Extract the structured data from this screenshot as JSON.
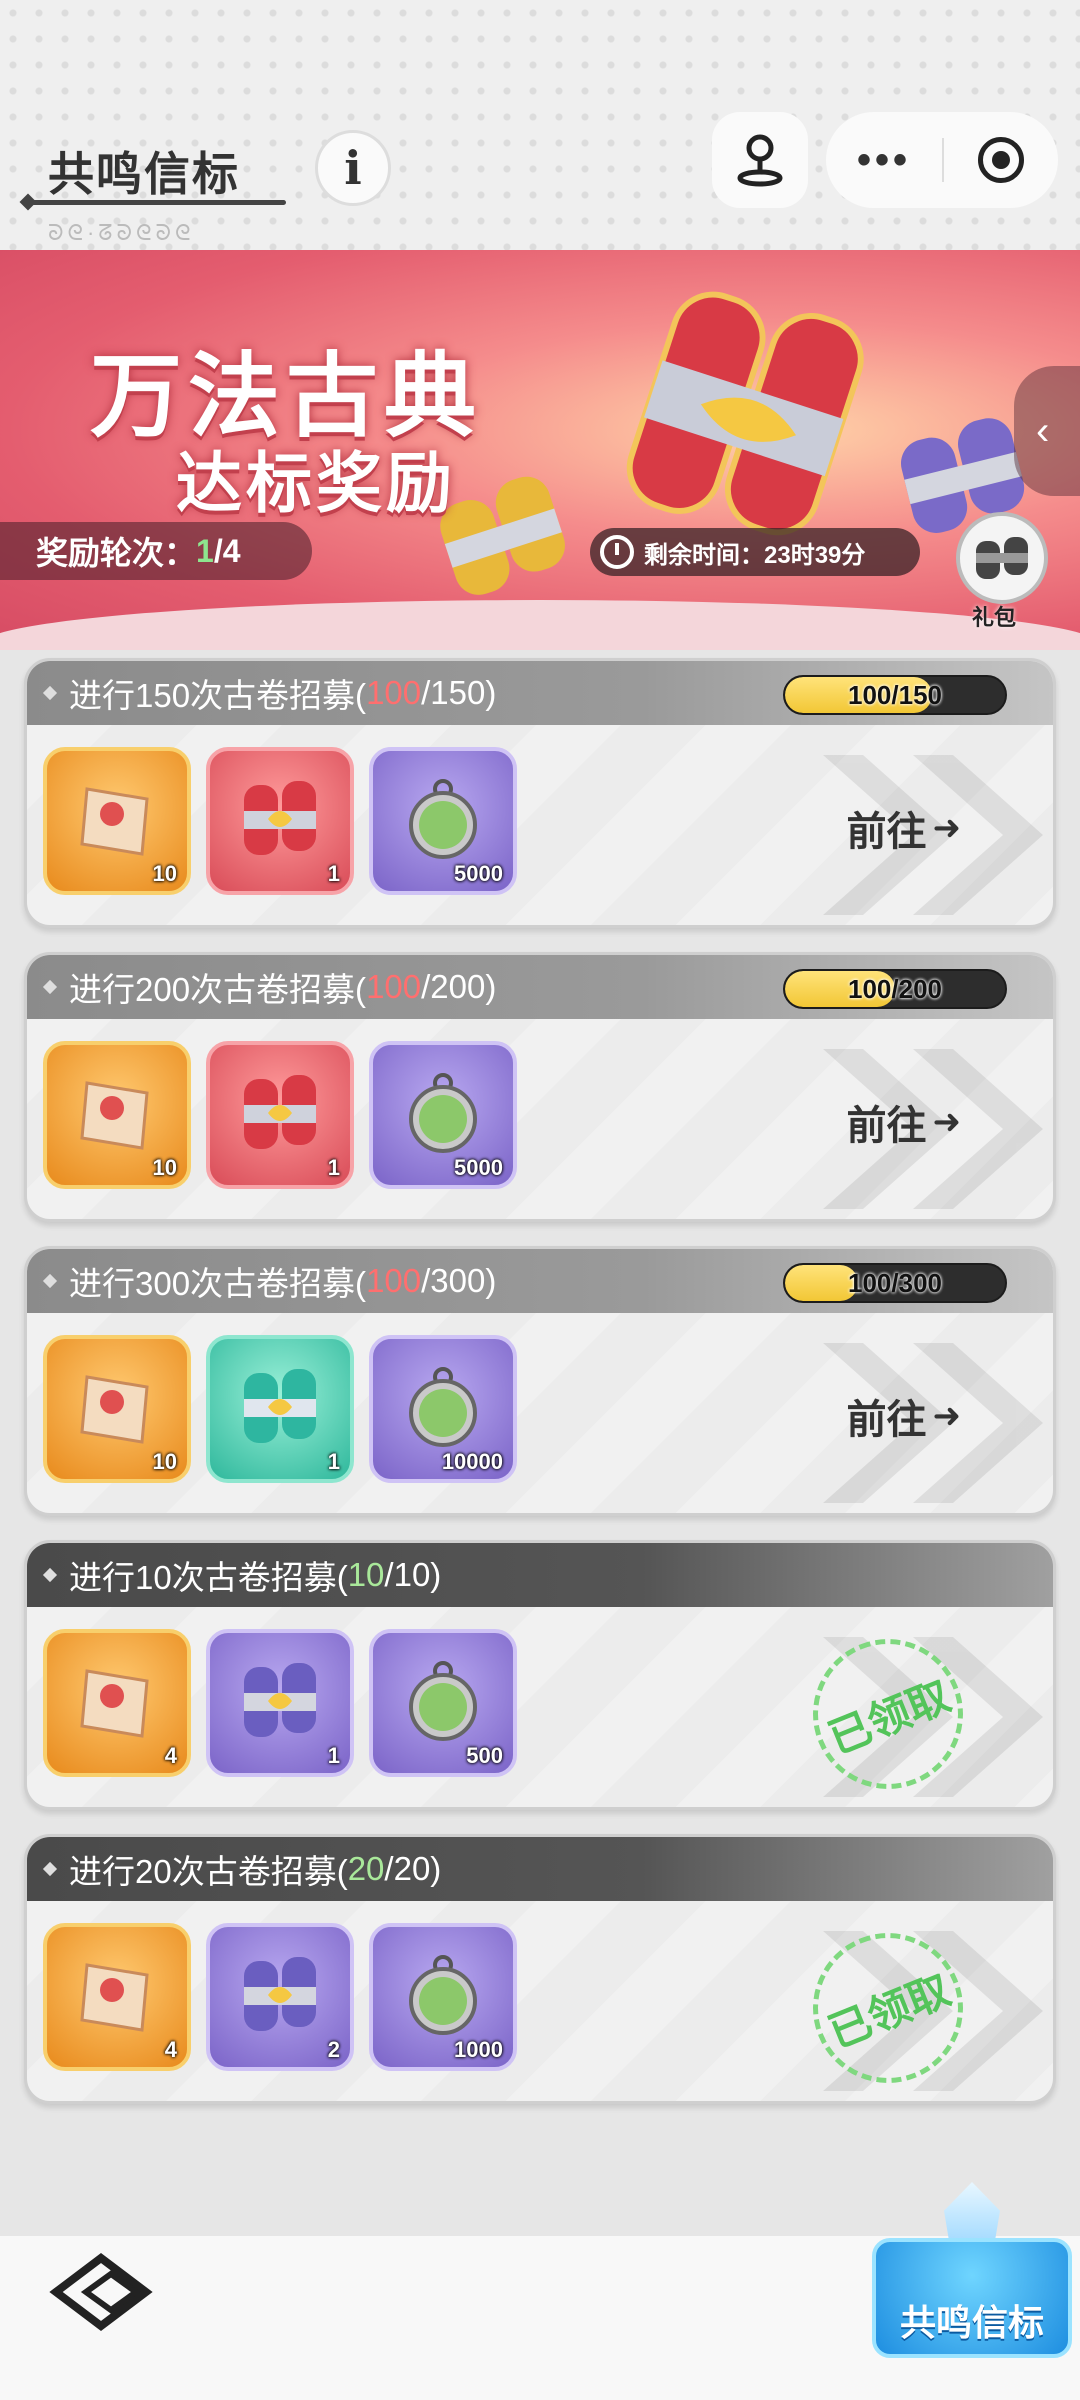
{
  "header": {
    "title": "共鸣信标",
    "subscript": "ᘐᘓ·ᘔᘐᘓᘐᘓ",
    "info_icon": "info-icon",
    "pin_icon": "joystick-pin-icon",
    "more_icon": "more-dots-icon",
    "close_icon": "record-circle-icon"
  },
  "banner": {
    "title_line1": "万法古典",
    "title_line2": "达标奖励",
    "round_label": "奖励轮次：",
    "round_current": "1",
    "round_total": "/4",
    "timer_label": "剩余时间：23时39分",
    "gift_label": "礼包",
    "side_arrow": "‹"
  },
  "colors": {
    "accent_yellow": "#f2c735",
    "progress_red": "#ff6f6f",
    "progress_green": "#a9e89a",
    "claimed_green": "#53c45a",
    "banner_pink": "#e45d6f"
  },
  "tasks": [
    {
      "title_prefix": "进行150次古卷招募(",
      "progress_current": "100",
      "progress_suffix": "/150)",
      "bar_text": "100/150",
      "bar_fraction": 0.667,
      "status": "go",
      "action_label": "前往",
      "rewards": [
        {
          "icon": "scroll-paper-icon",
          "count": "10",
          "rarity": "orange"
        },
        {
          "icon": "red-scroll-bundle-icon",
          "count": "1",
          "rarity": "red"
        },
        {
          "icon": "green-coin-icon",
          "count": "5000",
          "rarity": "purple"
        }
      ]
    },
    {
      "title_prefix": "进行200次古卷招募(",
      "progress_current": "100",
      "progress_suffix": "/200)",
      "bar_text": "100/200",
      "bar_fraction": 0.5,
      "status": "go",
      "action_label": "前往",
      "rewards": [
        {
          "icon": "scroll-paper-icon",
          "count": "10",
          "rarity": "orange"
        },
        {
          "icon": "red-scroll-bundle-icon",
          "count": "1",
          "rarity": "red"
        },
        {
          "icon": "green-coin-icon",
          "count": "5000",
          "rarity": "purple"
        }
      ]
    },
    {
      "title_prefix": "进行300次古卷招募(",
      "progress_current": "100",
      "progress_suffix": "/300)",
      "bar_text": "100/300",
      "bar_fraction": 0.333,
      "status": "go",
      "action_label": "前往",
      "rewards": [
        {
          "icon": "scroll-paper-icon",
          "count": "10",
          "rarity": "orange"
        },
        {
          "icon": "teal-scroll-bundle-icon",
          "count": "1",
          "rarity": "teal"
        },
        {
          "icon": "green-coin-icon",
          "count": "10000",
          "rarity": "purple"
        }
      ]
    },
    {
      "title_prefix": "进行10次古卷招募(",
      "progress_current": "10",
      "progress_suffix": "/10)",
      "status": "claimed",
      "action_label": "已领取",
      "rewards": [
        {
          "icon": "scroll-paper-icon",
          "count": "4",
          "rarity": "orange"
        },
        {
          "icon": "purple-scroll-bundle-icon",
          "count": "1",
          "rarity": "purple"
        },
        {
          "icon": "green-coin-icon",
          "count": "500",
          "rarity": "purple"
        }
      ]
    },
    {
      "title_prefix": "进行20次古卷招募(",
      "progress_current": "20",
      "progress_suffix": "/20)",
      "status": "claimed",
      "action_label": "已领取",
      "rewards": [
        {
          "icon": "scroll-paper-icon",
          "count": "4",
          "rarity": "orange"
        },
        {
          "icon": "purple-scroll-bundle-icon",
          "count": "2",
          "rarity": "purple"
        },
        {
          "icon": "green-coin-icon",
          "count": "1000",
          "rarity": "purple"
        }
      ]
    }
  ],
  "footer": {
    "back_icon": "back-arrow-icon",
    "resonance_label": "共鸣信标"
  }
}
